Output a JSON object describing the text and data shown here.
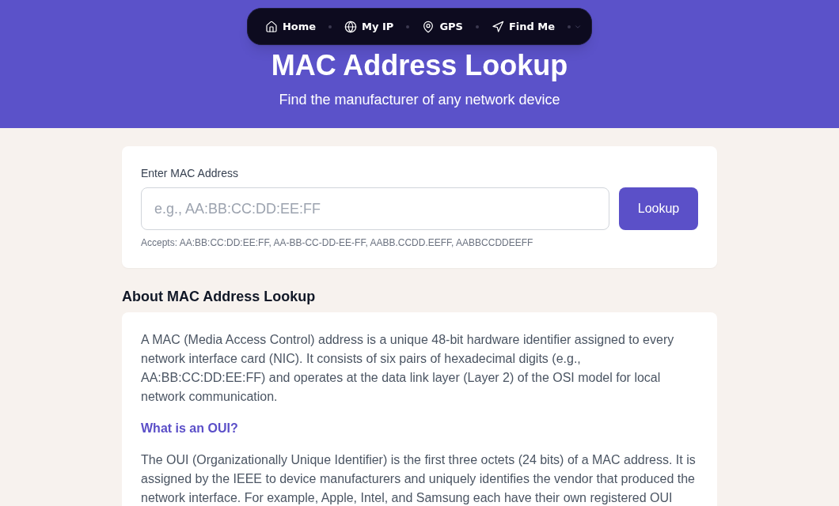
{
  "nav": {
    "items": [
      {
        "label": "Home"
      },
      {
        "label": "My IP"
      },
      {
        "label": "GPS"
      },
      {
        "label": "Find Me"
      }
    ]
  },
  "header": {
    "title": "MAC Address Lookup",
    "subtitle": "Find the manufacturer of any network device"
  },
  "lookup": {
    "label": "Enter MAC Address",
    "input": {
      "placeholder": "e.g., AA:BB:CC:DD:EE:FF"
    },
    "button": "Lookup",
    "hint": "Accepts: AA:BB:CC:DD:EE:FF, AA-BB-CC-DD-EE-FF, AABB.CCDD.EEFF, AABBCCDDEEFF"
  },
  "about": {
    "title": "About MAC Address Lookup",
    "sections": [
      {
        "kind": "paragraph",
        "text": "A MAC (Media Access Control) address is a unique 48-bit hardware identifier assigned to every network interface card (NIC). It consists of six pairs of hexadecimal digits (e.g., AA:BB:CC:DD:EE:FF) and operates at the data link layer (Layer 2) of the OSI model for local network communication."
      },
      {
        "kind": "heading",
        "text": "What is an OUI?"
      },
      {
        "kind": "paragraph",
        "text": "The OUI (Organizationally Unique Identifier) is the first three octets (24 bits) of a MAC address. It is assigned by the IEEE to device manufacturers and uniquely identifies the vendor that produced the network interface. For example, Apple, Intel, and Samsung each have their own registered OUI"
      }
    ]
  }
}
